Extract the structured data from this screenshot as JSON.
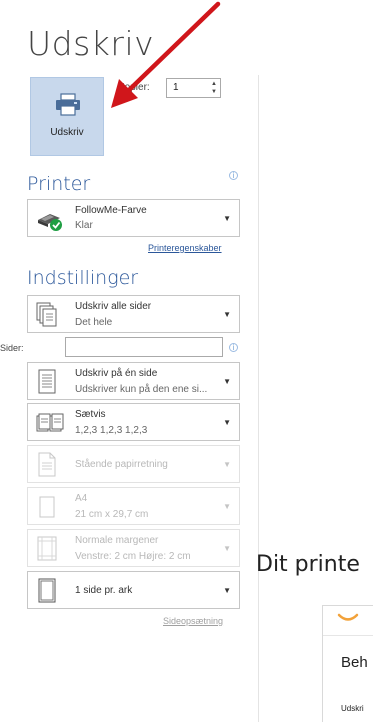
{
  "header": {
    "title": "Udskriv"
  },
  "print": {
    "button_label": "Udskriv",
    "copies_label": "Kopier:",
    "copies_value": "1"
  },
  "printer": {
    "section_title": "Printer",
    "name": "FollowMe-Farve",
    "status": "Klar",
    "properties_link": "Printeregenskaber"
  },
  "settings": {
    "section_title": "Indstillinger",
    "pages_label": "Sider:",
    "pages_value": "",
    "items": [
      {
        "line1": "Udskriv alle sider",
        "line2": "Det hele",
        "enabled": true
      },
      {
        "line1": "Udskriv på én side",
        "line2": "Udskriver kun på den ene si...",
        "enabled": true
      },
      {
        "line1": "Sætvis",
        "line2": "1,2,3   1,2,3   1,2,3",
        "enabled": true
      },
      {
        "line1": "Stående papirretning",
        "line2": "",
        "enabled": false
      },
      {
        "line1": "A4",
        "line2": "21 cm x 29,7 cm",
        "enabled": false
      },
      {
        "line1": "Normale margener",
        "line2": "Venstre: 2 cm   Højre: 2 cm",
        "enabled": false
      },
      {
        "line1": "1 side pr. ark",
        "line2": "",
        "enabled": true
      }
    ],
    "page_setup_link": "Sideopsætning"
  },
  "preview": {
    "message": "Dit printe",
    "card_heading": "Beh",
    "card_sub": "Udskri"
  },
  "colors": {
    "accent": "#2b579a",
    "button_bg": "#c8d8ec",
    "arrow": "#d0161b",
    "ready_green": "#1f9e43"
  }
}
